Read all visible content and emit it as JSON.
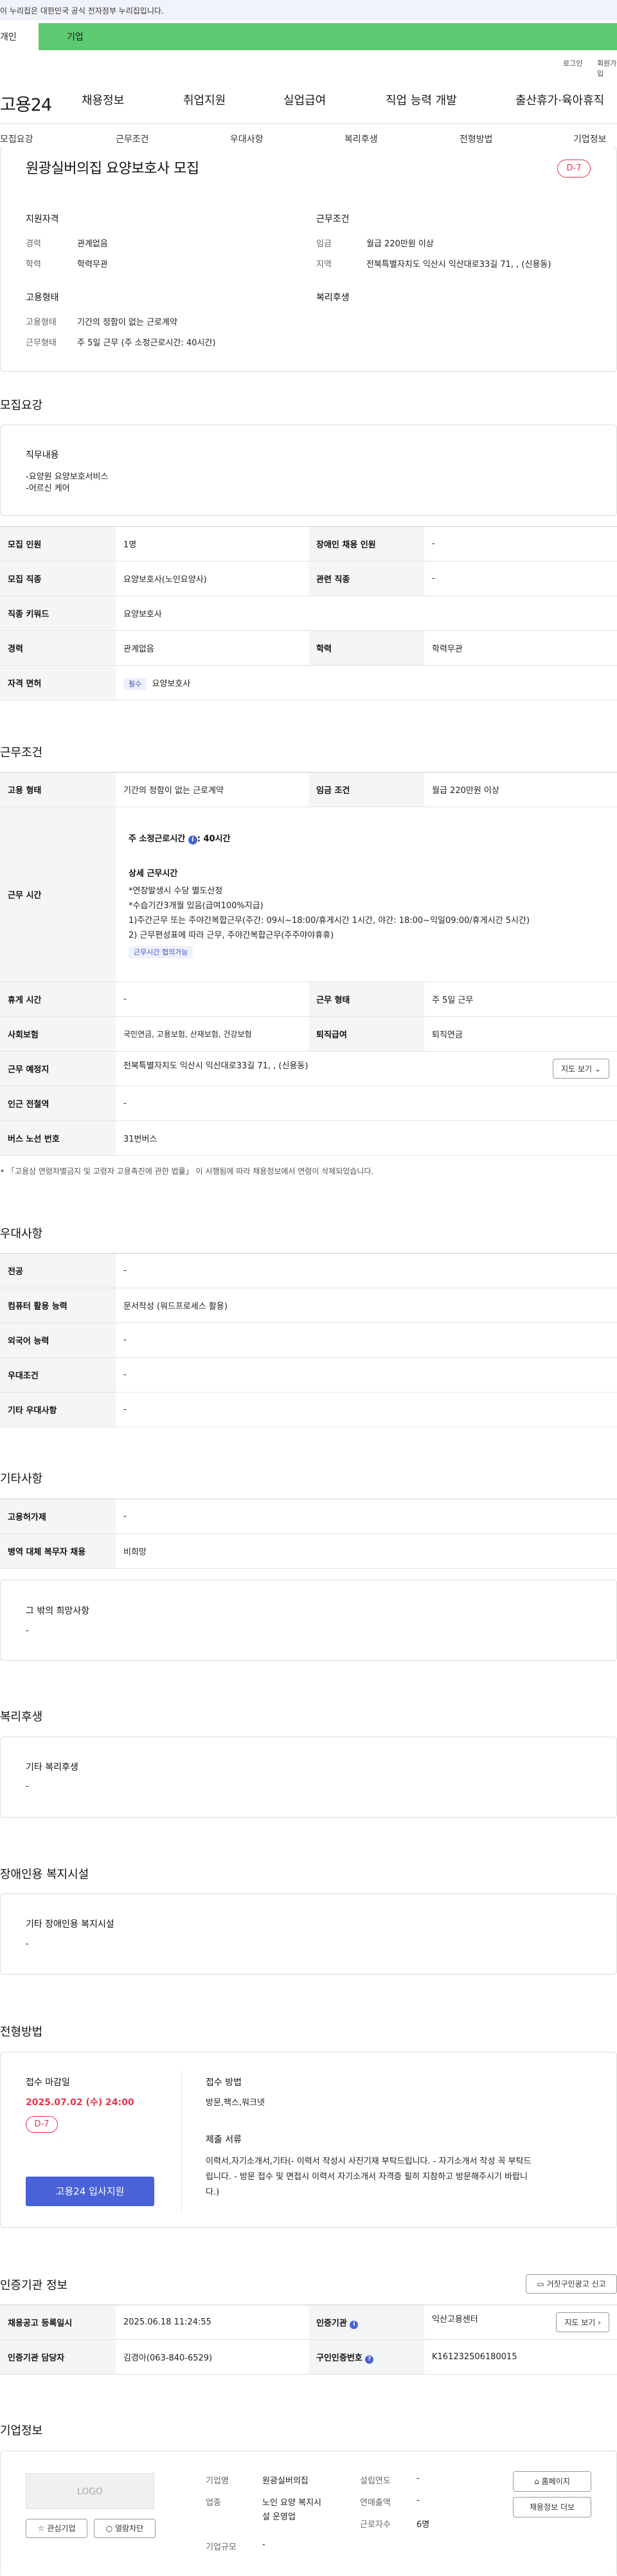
{
  "gov_banner": "이 누리집은 대한민국 공식 전자정부 누리집입니다.",
  "top_tabs": {
    "individual": "개인",
    "company": "기업"
  },
  "util": {
    "login": "로그인",
    "signup": "회원가입"
  },
  "logo": "고용24",
  "gnb": [
    "채용정보",
    "취업지원",
    "실업급여",
    "직업 능력 개발",
    "출산휴가·육아휴직"
  ],
  "snb": [
    "모집요강",
    "근무조건",
    "우대사항",
    "복리후생",
    "전형방법",
    "기업정보"
  ],
  "summary": {
    "title": "원광실버의집 요양보호사 모집",
    "dday": "D-7",
    "qualification": {
      "heading": "지원자격",
      "rows": [
        {
          "k": "경력",
          "v": "관계없음"
        },
        {
          "k": "학력",
          "v": "학력무관"
        }
      ]
    },
    "conditions": {
      "heading": "근무조건",
      "rows": [
        {
          "k": "임금",
          "v": "월급 220만원 이상"
        },
        {
          "k": "지역",
          "v": "전북특별자치도 익산시 익산대로33길 71, , (신용동)"
        }
      ]
    },
    "employment": {
      "heading": "고용형태",
      "rows": [
        {
          "k": "고용형태",
          "v": "기간의 정함이 없는 근로계약"
        },
        {
          "k": "근무형태",
          "v": "주 5일 근무 (주 소정근로시간: 40시간)"
        }
      ]
    },
    "welfare": {
      "heading": "복리후생"
    }
  },
  "recruit": {
    "heading": "모집요강",
    "duty_title": "직무내용",
    "duty_lines": [
      "-요양원 요양보호서비스",
      "-어르신 케어"
    ],
    "rows": [
      {
        "k1": "모집 인원",
        "v1": "1명",
        "k2": "장애인 채용 인원",
        "v2": "-"
      },
      {
        "k1": "모집 직종",
        "v1": "요양보호사(노인요양사)",
        "k2": "관련 직종",
        "v2": "-"
      },
      {
        "k1": "직종 키워드",
        "v1": "요양보호사",
        "k2": "",
        "v2": ""
      },
      {
        "k1": "경력",
        "v1": "관계없음",
        "k2": "학력",
        "v2": "학력무관"
      }
    ],
    "license_label": "자격 면허",
    "license_badge": "필수",
    "license_value": "요양보호사"
  },
  "work": {
    "heading": "근무조건",
    "emp_type_k": "고용 형태",
    "emp_type_v": "기간의 정함이 없는 근로계약",
    "wage_k": "임금 조건",
    "wage_v": "월급 220만원 이상",
    "hours_k": "근무 시간",
    "hours_main": "주 소정근로시간",
    "hours_value": ": 40시간",
    "hours_detail_title": "상세 근무시간",
    "hours_lines": [
      "*연장발생시 수당 별도산정",
      "*수습기간3개월 있음(급여100%지급)",
      "1)주간근무 또는 주야간복합근무(주간: 09시~18:00/휴게시간 1시간, 야간: 18:00~익일09:00/휴게시간 5시간)",
      "2) 근무편성표에 따라 근무, 주야간복합근무(주주야야휴휴)"
    ],
    "hours_badge": "근무시간 협의가능",
    "rows": [
      {
        "k1": "휴게 시간",
        "v1": "-",
        "k2": "근무 형태",
        "v2": "주 5일 근무"
      },
      {
        "k1": "사회보험",
        "v1": "국민연금, 고용보험, 산재보험, 건강보험",
        "k2": "퇴직급여",
        "v2": "퇴직연금"
      }
    ],
    "place_k": "근무 예정지",
    "place_v": "전북특별자치도 익산시 익산대로33길 71, , (신용동)",
    "map_btn": "지도 보기",
    "station_k": "인근 전철역",
    "station_v": "-",
    "bus_k": "버스 노선 번호",
    "bus_v": "31번버스",
    "note": "「고용상 연령차별금지 및 고령자 고용촉진에 관한 법률」 이 시행됨에 따라 채용정보에서 연령이 삭제되었습니다."
  },
  "preference": {
    "heading": "우대사항",
    "rows": [
      {
        "k": "전공",
        "v": "-"
      },
      {
        "k": "컴퓨터 활용 능력",
        "v": "문서작성 (워드프로세스 활용)"
      },
      {
        "k": "외국어 능력",
        "v": "-"
      },
      {
        "k": "우대조건",
        "v": "-"
      },
      {
        "k": "기타 우대사항",
        "v": "-"
      }
    ]
  },
  "others": {
    "heading": "기타사항",
    "rows": [
      {
        "k": "고용허가제",
        "v": "-"
      },
      {
        "k": "병역 대체 복무자 채용",
        "v": "비희망"
      }
    ],
    "box_title": "그 밖의 희망사항",
    "box_value": "-"
  },
  "welfare": {
    "heading": "복리후생",
    "box_title": "기타 복리후생",
    "box_value": "-"
  },
  "disabled": {
    "heading": "장애인용 복지시설",
    "box_title": "기타 장애인용 복지시설",
    "box_value": "-"
  },
  "selection": {
    "heading": "전형방법",
    "deadline_title": "접수 마감일",
    "deadline": "2025.07.02 (수) 24:00",
    "dday": "D-7",
    "apply_btn": "고용24 입사지원",
    "method_title": "접수 방법",
    "method": "방문,팩스,워크넷",
    "docs_title": "제출 서류",
    "docs_lines": [
      "이력서,자기소개서,기타(- 이력서 작성시 사진기재 부탁드립니다. - 자기소개서 작성 꼭 부탁드",
      "립니다. - 방문 접수 및 면접시 이력서 자기소개서 자격증 필히 지참하고 방문해주시기 바랍니",
      "다.)"
    ]
  },
  "agency": {
    "heading": "인증기관 정보",
    "report_btn": "거짓구인광고 신고",
    "rows": [
      {
        "k1": "채용공고 등록일시",
        "v1": "2025.06.18 11:24:55",
        "k2": "인증기관",
        "v2": "익산고용센터"
      },
      {
        "k1": "인증기관 담당자",
        "v1": "김경아(063-840-6529)",
        "k2": "구인인증번호",
        "v2": "K161232506180015"
      }
    ],
    "map_btn": "지도 보기"
  },
  "company": {
    "heading": "기업정보",
    "logo": "LOGO",
    "fav_btn": "관심기업",
    "block_btn": "열람차단",
    "name_k": "기업명",
    "name_v": "원광실버의집",
    "ind_k": "업종",
    "ind_v1": "노인 요양 복지시",
    "ind_v2": "설 운영업",
    "size_k": "기업규모",
    "size_v": "-",
    "year_k": "설립연도",
    "year_v": "-",
    "sales_k": "연매출액",
    "sales_v": "-",
    "emp_k": "근로자수",
    "emp_v": "6명",
    "home_btn": "홈페이지",
    "jobs_btn": "채용정보 더보"
  },
  "colors": {
    "accent_green": "#5dc971",
    "dday_red": "#e8334b",
    "apply_blue": "#4a62d8"
  }
}
